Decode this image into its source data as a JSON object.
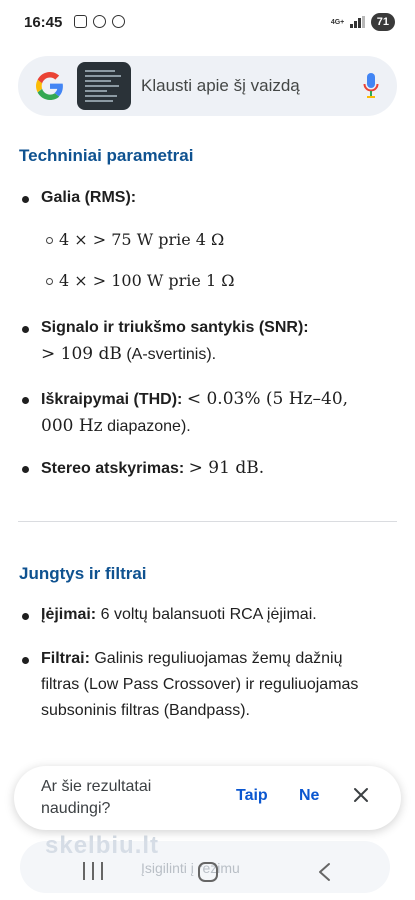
{
  "status_bar": {
    "time": "16:45",
    "network": "4G+",
    "battery": "71"
  },
  "search": {
    "placeholder": "Klausti apie šį vaizdą"
  },
  "sections": [
    {
      "title": "Techniniai parametrai",
      "items": [
        {
          "label": "Galia (RMS):",
          "value": "",
          "subitems": [
            "4 × > 75 W prie 4 Ω",
            "4 × > 100 W prie 1 Ω"
          ]
        },
        {
          "label": "Signalo ir triukšmo santykis (SNR):",
          "value_line1": "> 109 dB",
          "value_line2": "(A-svertinis)."
        },
        {
          "label": "Iškraipymai (THD):",
          "value_line1": "< 0.03% (5 Hz–40,",
          "value_line2": "000 Hz",
          "value_line3": "diapazone)."
        },
        {
          "label": "Stereo atskyrimas:",
          "value_line1": "> 91 dB."
        }
      ]
    },
    {
      "title": "Jungtys ir filtrai",
      "items": [
        {
          "label": "Įėjimai:",
          "value": "6 voltų balansuoti RCA įėjimai."
        },
        {
          "label": "Filtrai:",
          "value": "Galinis reguliuojamas žemų dažnių filtras (Low Pass Crossover) ir reguliuojamas subsoninis filtras (Bandpass)."
        }
      ]
    }
  ],
  "feedback": {
    "question": "Ar šie rezultatai naudingi?",
    "yes": "Taip",
    "no": "Ne"
  },
  "background": {
    "watermark": "skelbiu.lt",
    "mode_text": "Įsigilinti į režimu"
  },
  "colors": {
    "section_title": "#0f5290",
    "action": "#0b57d0",
    "search_bg": "#eef1f6"
  }
}
